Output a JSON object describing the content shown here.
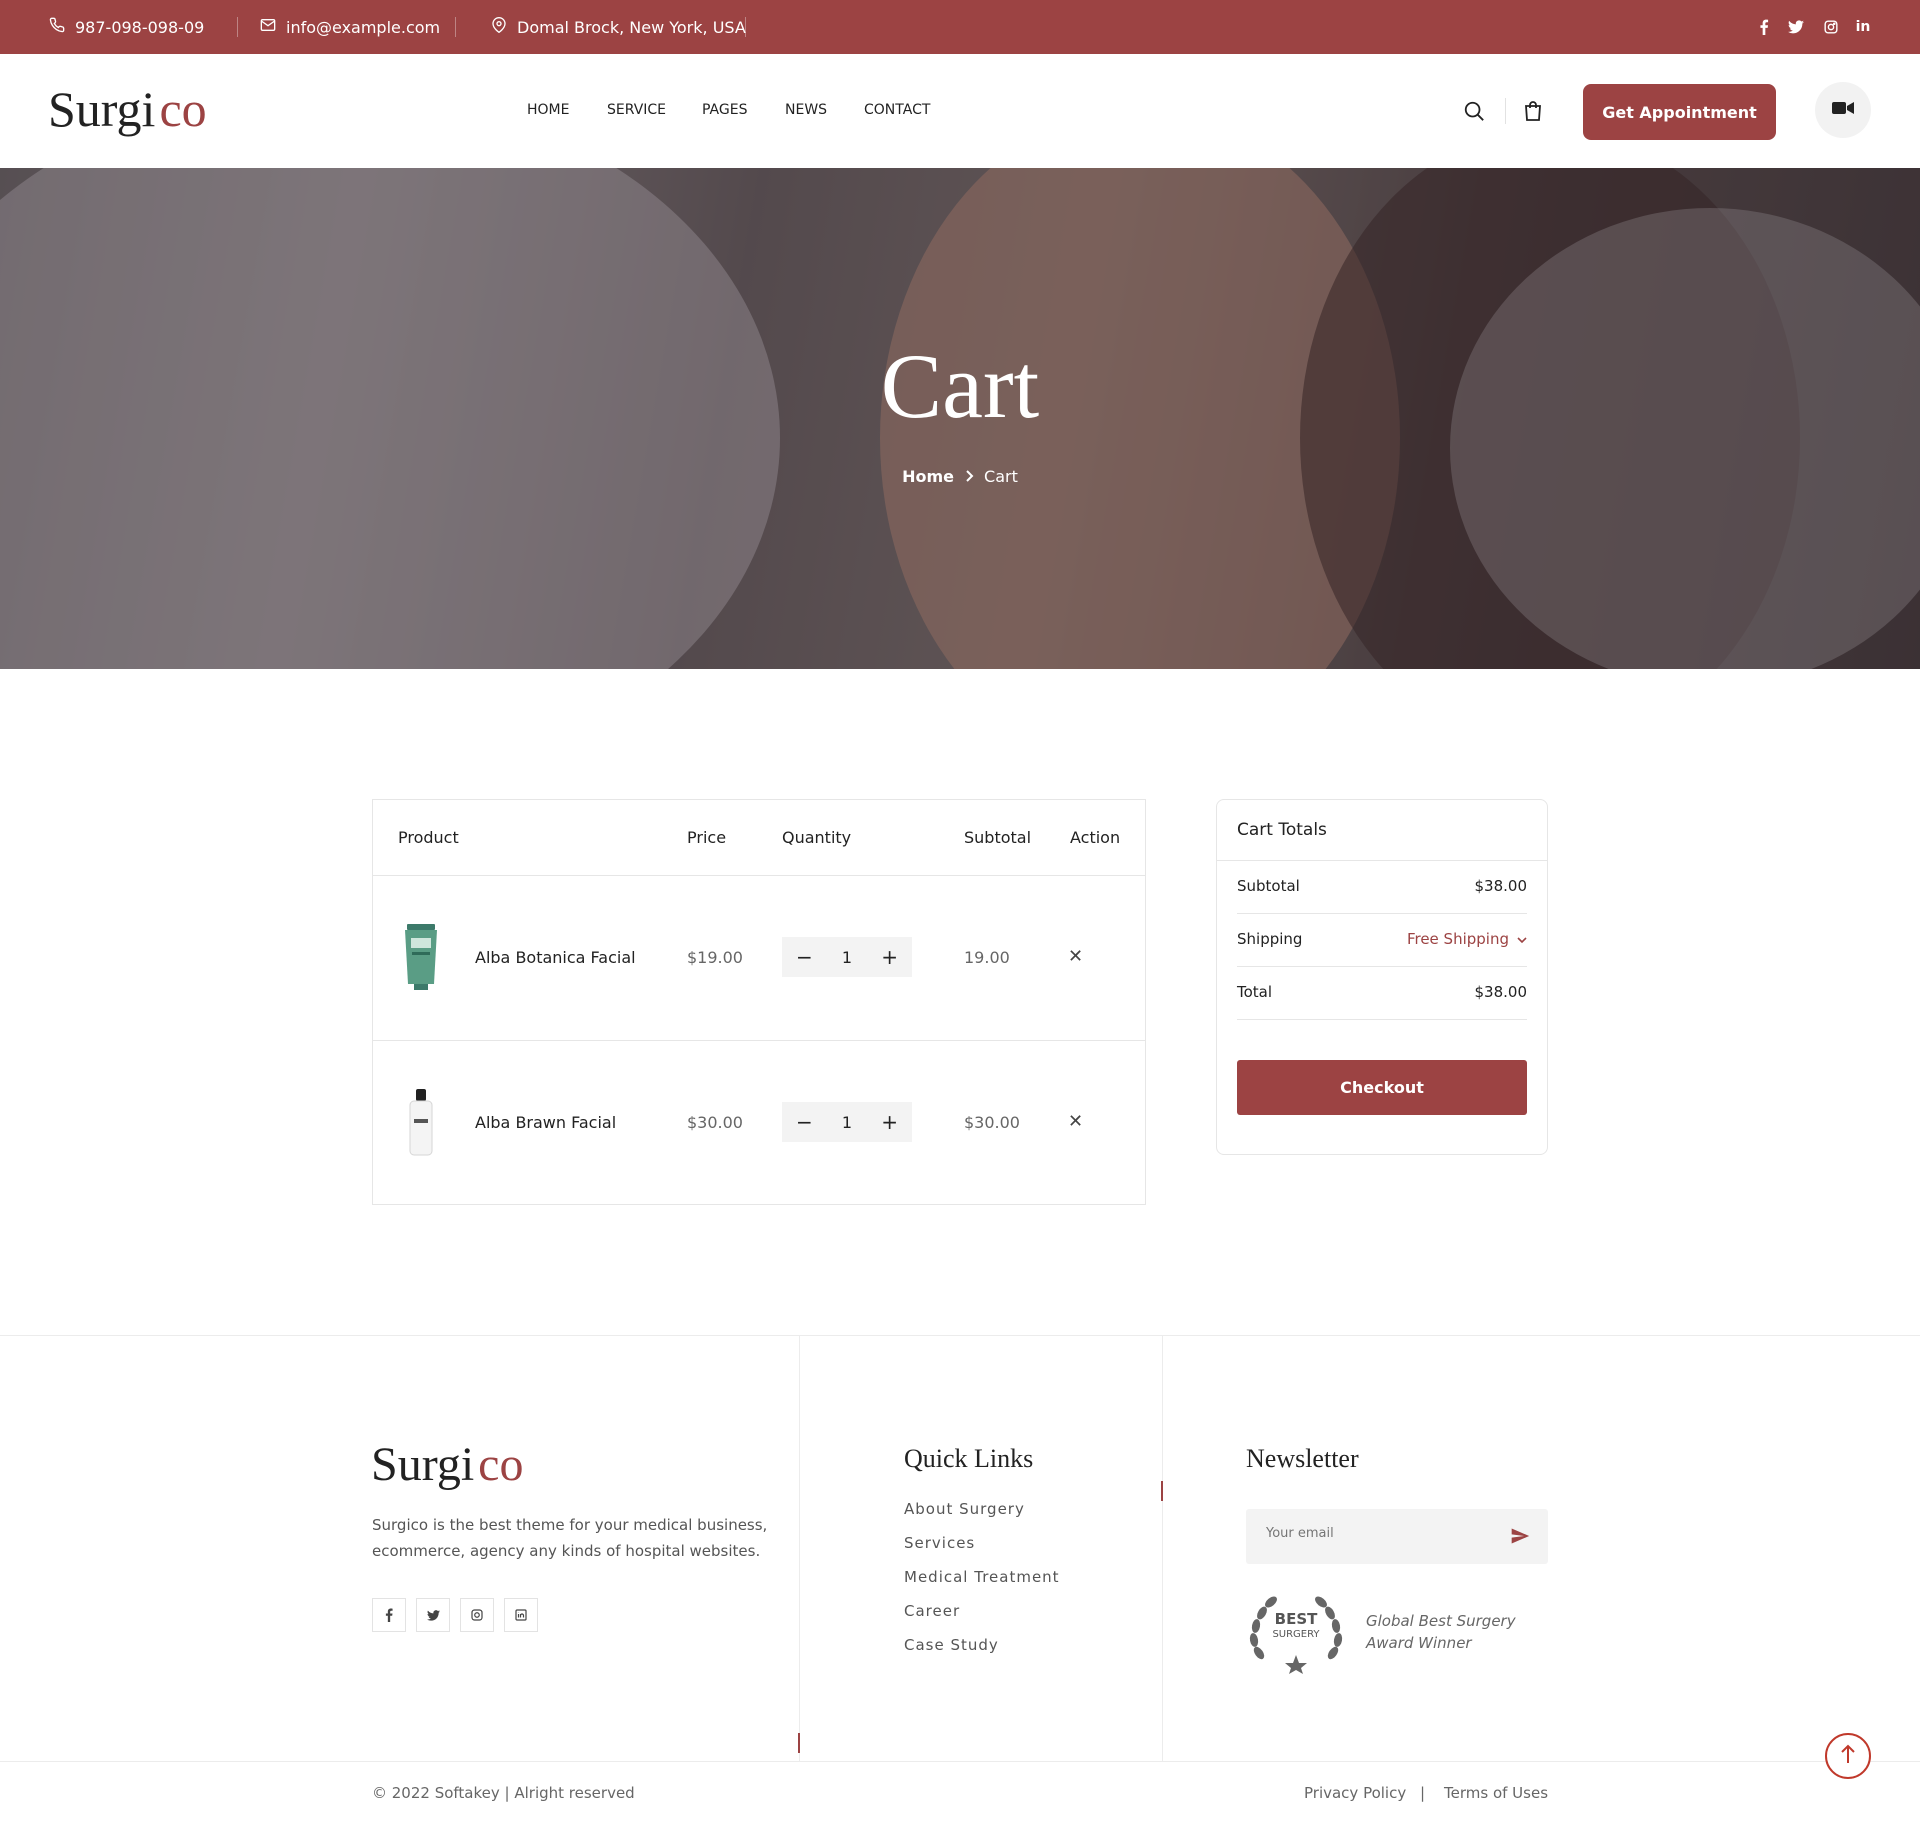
{
  "topbar": {
    "phone": "987-098-098-09",
    "email": "info@example.com",
    "address": "Domal Brock, New York, USA",
    "socials": [
      "facebook-icon",
      "twitter-icon",
      "instagram-icon",
      "linkedin-icon"
    ]
  },
  "header": {
    "logo_part1": "Surgi",
    "logo_part2": "co",
    "nav": [
      "HOME",
      "SERVICE",
      "PAGES",
      "NEWS",
      "CONTACT"
    ],
    "appointment_label": "Get Appointment"
  },
  "hero": {
    "title": "Cart",
    "breadcrumb_home": "Home",
    "breadcrumb_current": "Cart"
  },
  "cart": {
    "headers": {
      "product": "Product",
      "price": "Price",
      "quantity": "Quantity",
      "subtotal": "Subtotal",
      "action": "Action"
    },
    "items": [
      {
        "name": "Alba Botanica Facial",
        "price": "$19.00",
        "qty": "1",
        "subtotal": "19.00",
        "thumb": "green-tube"
      },
      {
        "name": "Alba Brawn Facial",
        "price": "$30.00",
        "qty": "1",
        "subtotal": "$30.00",
        "thumb": "white-bottle"
      }
    ]
  },
  "totals": {
    "title": "Cart Totals",
    "subtotal_label": "Subtotal",
    "subtotal_value": "$38.00",
    "shipping_label": "Shipping",
    "shipping_value": "Free Shipping",
    "total_label": "Total",
    "total_value": "$38.00",
    "checkout_label": "Checkout"
  },
  "footer": {
    "logo_part1": "Surgi",
    "logo_part2": "co",
    "description": "Surgico is the best theme for your medical business, ecommerce, agency any kinds of hospital websites.",
    "quick_links_title": "Quick Links",
    "quick_links": [
      "About Surgery",
      "Services",
      "Medical Treatment",
      "Career",
      "Case Study"
    ],
    "newsletter_title": "Newsletter",
    "email_placeholder": "Your email",
    "badge_line1": "BEST",
    "badge_line2": "SURGERY",
    "award_text": "Global Best Surgery Award Winner",
    "copyright": "© 2022 Softakey | Alright reserved",
    "privacy": "Privacy Policy",
    "divider": "|",
    "terms": "Terms of Uses"
  },
  "colors": {
    "brand": "#9c4343",
    "text": "#222222",
    "muted": "#666666"
  }
}
